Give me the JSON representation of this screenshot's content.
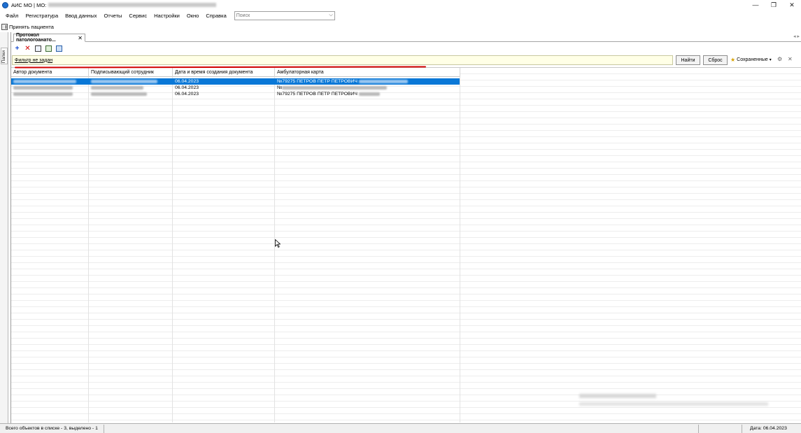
{
  "window": {
    "title_prefix": "АИС МО | МО:",
    "controls": {
      "minimize": "—",
      "restore": "❐",
      "close": "✕"
    }
  },
  "menu": {
    "items": [
      "Файл",
      "Регистратура",
      "Ввод данных",
      "Отчеты",
      "Сервис",
      "Настройки",
      "Окно",
      "Справка"
    ],
    "search_placeholder": "Поиск"
  },
  "accept_patient": {
    "label": "Принять пациента"
  },
  "side_panel": {
    "label": "Папки"
  },
  "document_tab": {
    "label": "Протокол патологоанато...",
    "close": "✕"
  },
  "filter": {
    "text": "Фильтр не задан",
    "find_label": "Найти",
    "reset_label": "Сброс",
    "saved_label": "Сохраненные"
  },
  "grid": {
    "columns": [
      "Автор документа",
      "Подписывающий сотрудник",
      "Дата и время создания документа",
      "Амбулаторная карта"
    ],
    "rows": [
      {
        "date": "06.04.2023",
        "card": "№79275 ПЕТРОВ ПЕТР ПЕТРОВИЧ",
        "selected": true
      },
      {
        "date": "06.04.2023",
        "card": "№",
        "selected": false
      },
      {
        "date": "06.04.2023",
        "card": "№79275 ПЕТРОВ ПЕТР ПЕТРОВИЧ",
        "selected": false
      }
    ]
  },
  "status": {
    "left": "Всего объектов в списке - 3, выделено - 1",
    "right": "Дата: 06.04.2023"
  },
  "colors": {
    "selection": "#0a78d7",
    "annotation_line": "#d10000",
    "filter_bg": "#ffffe6"
  }
}
